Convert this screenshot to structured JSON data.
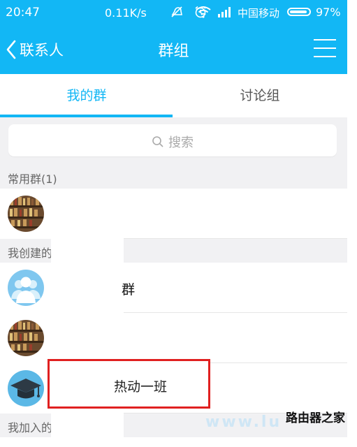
{
  "status_bar": {
    "time": "20:47",
    "speed": "0.11K/s",
    "carrier": "中国移动",
    "battery": "97%"
  },
  "header": {
    "back_label": "联系人",
    "title": "群组"
  },
  "tabs": [
    {
      "label": "我的群",
      "active": true
    },
    {
      "label": "讨论组",
      "active": false
    }
  ],
  "search": {
    "placeholder": "搜索"
  },
  "sections": {
    "frequent": "常用群(1)",
    "created": "我创建的",
    "joined": "我加入的"
  },
  "rows": {
    "frequent_1": "",
    "created_1": "群",
    "created_2": "",
    "created_3": "热动一班"
  },
  "watermark": {
    "text": "路由器之家",
    "sub": "www.lu"
  },
  "colors": {
    "accent": "#12b7f5",
    "highlight": "#e02020",
    "section_bg": "#f1f1f3"
  }
}
